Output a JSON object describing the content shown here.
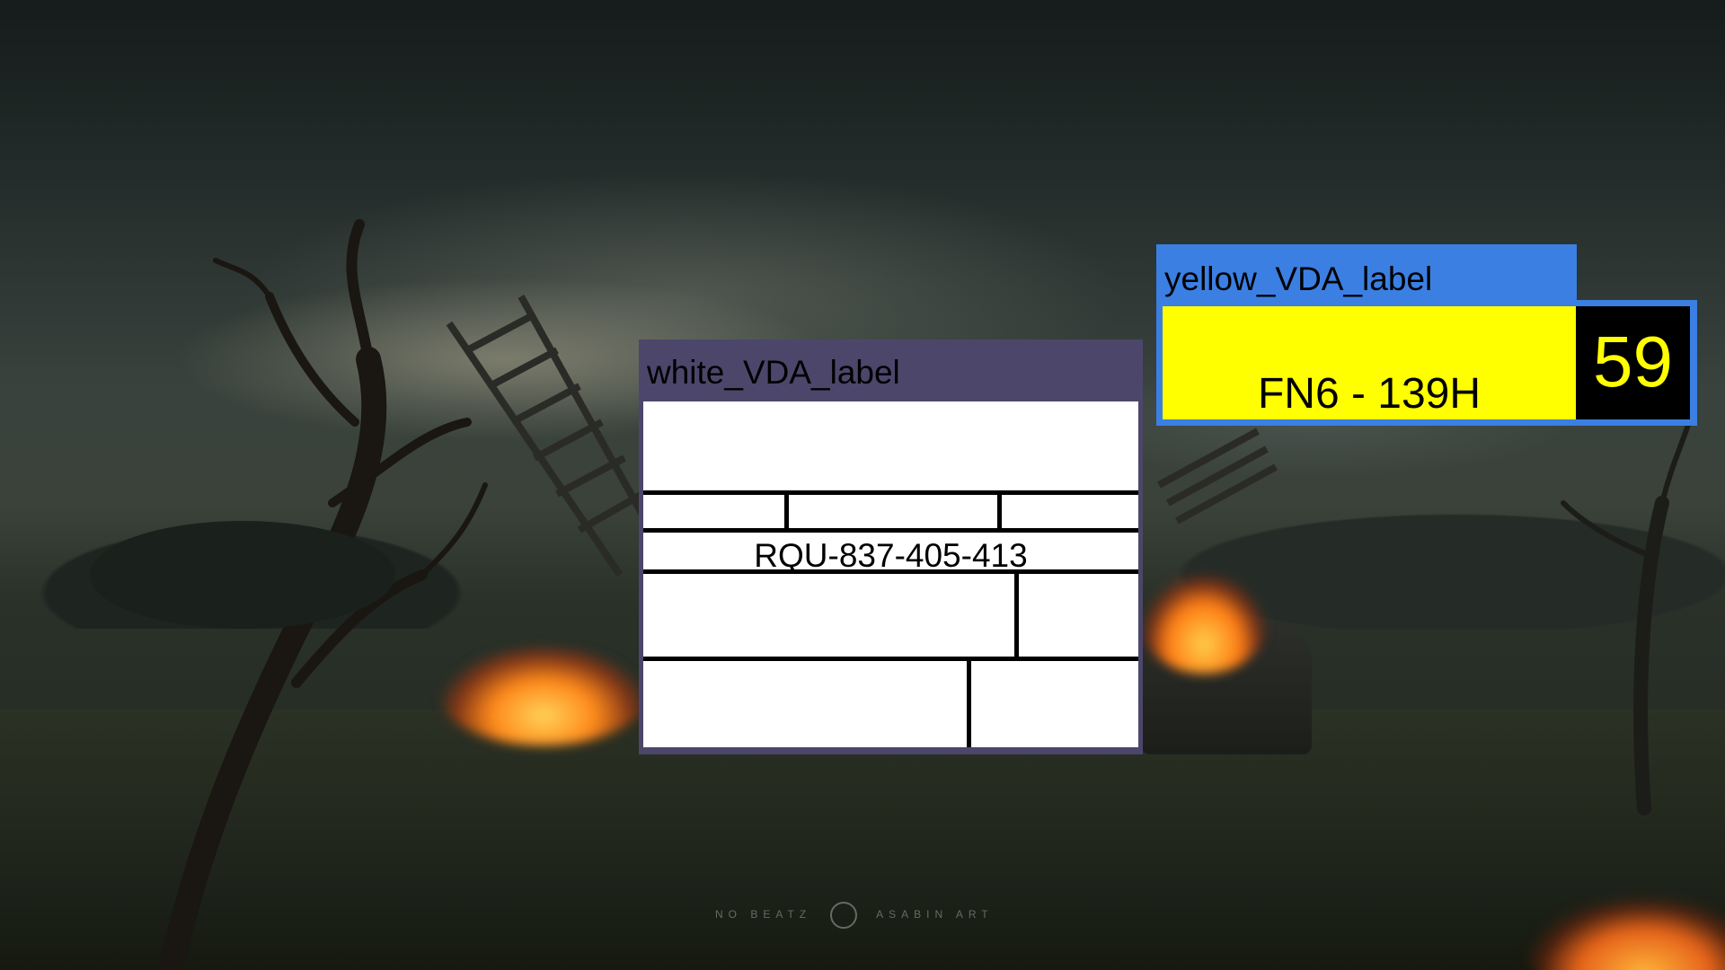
{
  "background": {
    "description_icon": "burning-wasteland-wallpaper",
    "credit_left": "NO BEATZ",
    "credit_right": "ASABIN ART"
  },
  "white_label": {
    "title": "white_VDA_label",
    "serial": "RQU-837-405-413",
    "colors": {
      "frame": "#4c466b",
      "sheet": "#ffffff",
      "lines": "#000000"
    }
  },
  "yellow_label": {
    "title": "yellow_VDA_label",
    "code": "FN6 - 139H",
    "number": "59",
    "colors": {
      "frame": "#3b7fe2",
      "field": "#ffff00",
      "number_bg": "#000000",
      "number_text": "#ffff00"
    }
  }
}
